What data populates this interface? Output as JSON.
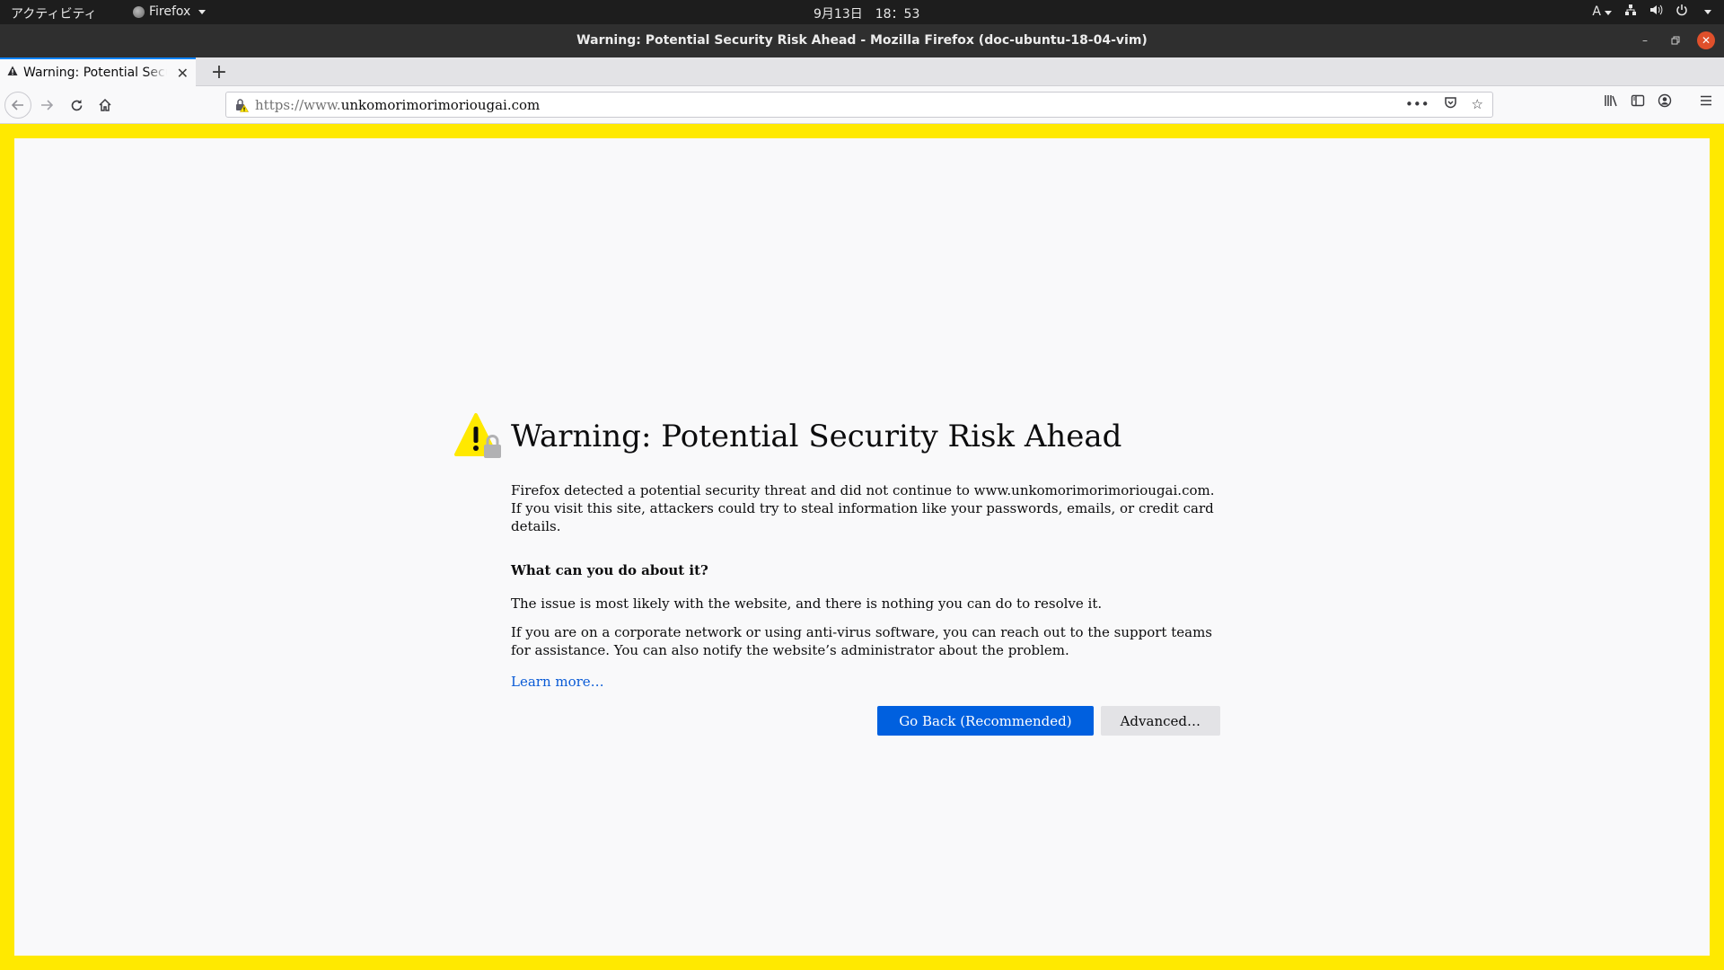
{
  "topbar": {
    "activities": "アクティビティ",
    "app_menu": "Firefox",
    "clock": "9月13日　18：53",
    "input_method": "A"
  },
  "window": {
    "title": "Warning: Potential Security Risk Ahead - Mozilla Firefox (doc-ubuntu-18-04-vim)"
  },
  "tabs": [
    {
      "label": "Warning: Potential Security Risk Ahead",
      "icon": "warning-icon"
    }
  ],
  "urlbar": {
    "prefix": "https://www.",
    "host": "unkomorimorimoriougai.com"
  },
  "error_page": {
    "title": "Warning: Potential Security Risk Ahead",
    "description": "Firefox detected a potential security threat and did not continue to www.unkomorimorimoriougai.com. If you visit this site, attackers could try to steal information like your passwords, emails, or credit card details.",
    "what_heading": "What can you do about it?",
    "para1": "The issue is most likely with the website, and there is nothing you can do to resolve it.",
    "para2": "If you are on a corporate network or using anti-virus software, you can reach out to the support teams for assistance. You can also notify the website’s administrator about the problem.",
    "learn_more": "Learn more…",
    "go_back": "Go Back (Recommended)",
    "advanced": "Advanced…"
  },
  "colors": {
    "border_yellow": "#ffe900",
    "primary_blue": "#0060df",
    "link_blue": "#0a5bd6"
  }
}
